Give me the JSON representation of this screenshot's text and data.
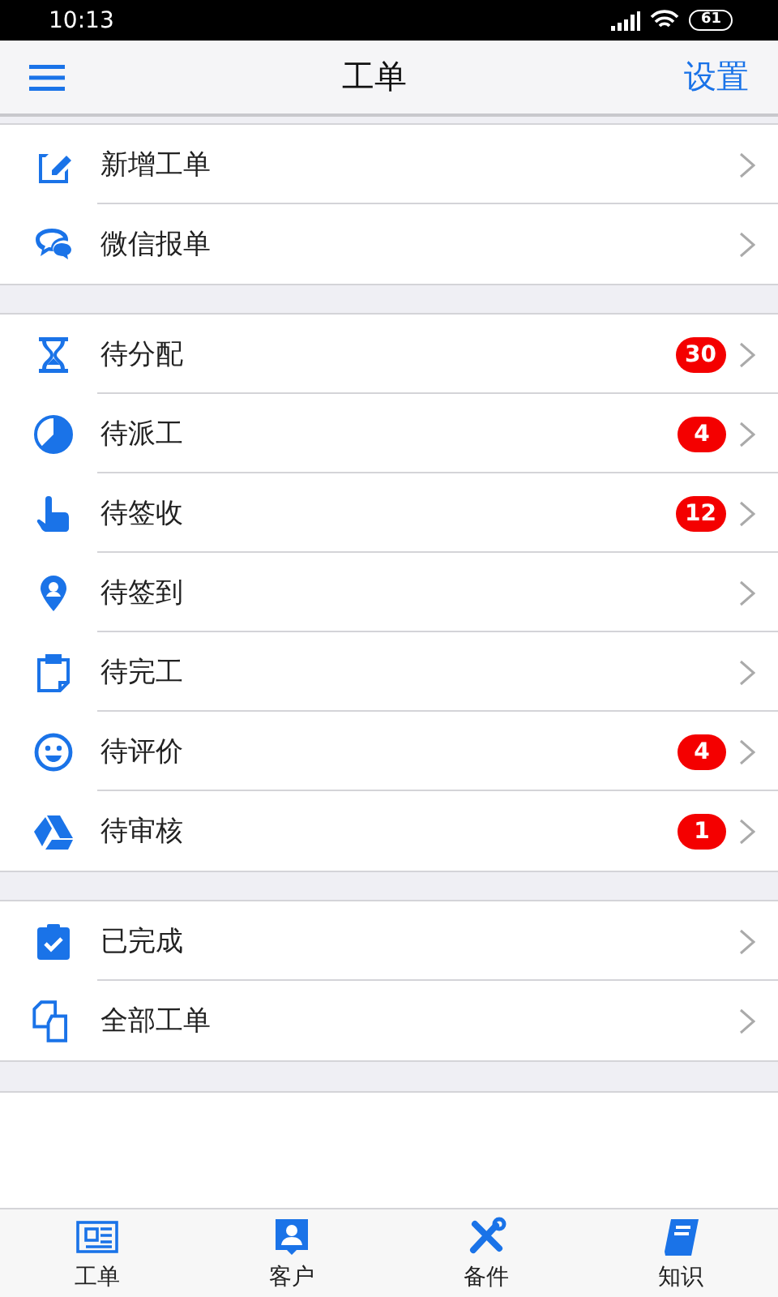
{
  "status_bar": {
    "time": "10:13",
    "battery": "61"
  },
  "header": {
    "title": "工单",
    "action": "设置"
  },
  "sections": [
    {
      "items": [
        {
          "label": "新增工单"
        },
        {
          "label": "微信报单"
        }
      ]
    },
    {
      "items": [
        {
          "label": "待分配",
          "badge": "30"
        },
        {
          "label": "待派工",
          "badge": "4"
        },
        {
          "label": "待签收",
          "badge": "12"
        },
        {
          "label": "待签到"
        },
        {
          "label": "待完工"
        },
        {
          "label": "待评价",
          "badge": "4"
        },
        {
          "label": "待审核",
          "badge": "1"
        }
      ]
    },
    {
      "items": [
        {
          "label": "已完成"
        },
        {
          "label": "全部工单"
        }
      ]
    }
  ],
  "tab_bar": [
    {
      "label": "工单"
    },
    {
      "label": "客户"
    },
    {
      "label": "备件"
    },
    {
      "label": "知识"
    }
  ]
}
